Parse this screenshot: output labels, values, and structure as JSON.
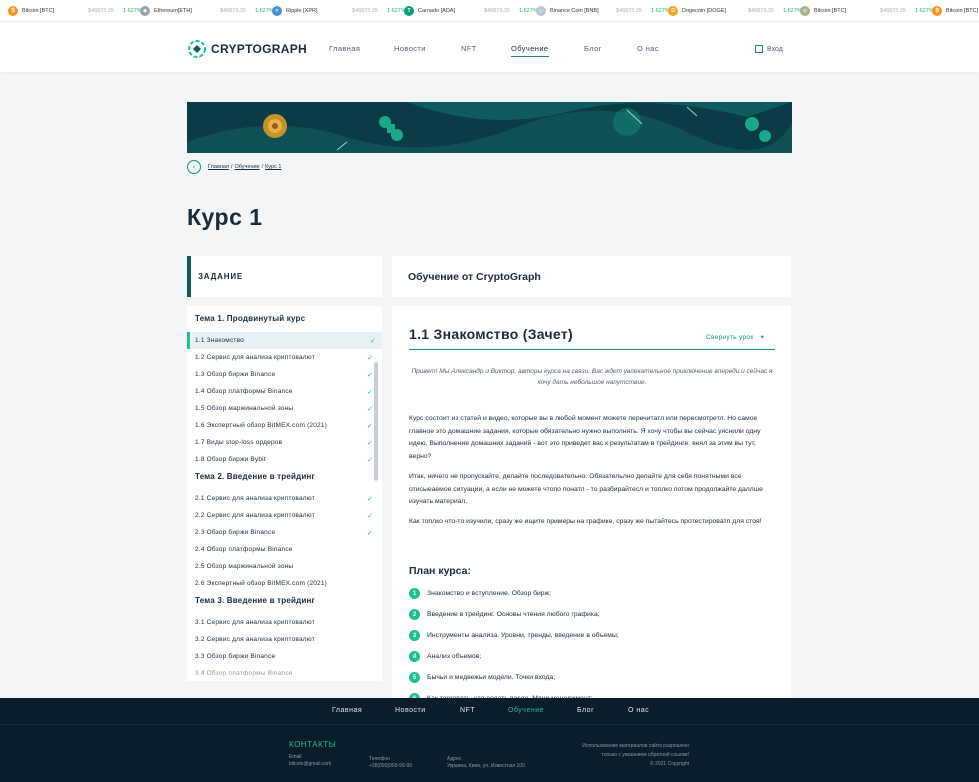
{
  "ticker": [
    {
      "name": "Bitcoin [BTC]",
      "price": "$46873.35",
      "change": "1.627%",
      "color": "#f7931a",
      "symbol": "₿"
    },
    {
      "name": "Ethereum[ETH]",
      "price": "$46873.35",
      "change": "1.627%",
      "color": "#9ea4ad",
      "symbol": "◆"
    },
    {
      "name": "Ripple [XPR]",
      "price": "$46873.35",
      "change": "1.627%",
      "color": "#4b8ed8",
      "symbol": "✕"
    },
    {
      "name": "Carnado [ADA]",
      "price": "$46873.35",
      "change": "1.627%",
      "color": "#0a9e7e",
      "symbol": "T"
    },
    {
      "name": "Binance Coin [BNB]",
      "price": "$46873.35",
      "change": "1.627%",
      "color": "#b9c7d4",
      "symbol": "◇"
    },
    {
      "name": "Dogecoin [DOGE]",
      "price": "$46873.35",
      "change": "1.627%",
      "color": "#f4a623",
      "symbol": "D"
    },
    {
      "name": "Bitcoin [BTC]",
      "price": "$46873.35",
      "change": "1.627%",
      "color": "#a3b18a",
      "symbol": "◎"
    },
    {
      "name": "Bitcoin [BTC]",
      "price": "",
      "change": "",
      "color": "#f7931a",
      "symbol": "₿"
    }
  ],
  "header": {
    "logo": "CRYPTOGRAPH",
    "nav": [
      "Главная",
      "Новости",
      "NFT",
      "Обучение",
      "Блог",
      "О нас"
    ],
    "active_nav": "Обучение",
    "login": "Вход"
  },
  "breadcrumb": [
    "Главная",
    "Обучение",
    "Курс 1"
  ],
  "page_title": "Курс 1",
  "sidebar": {
    "header": "ЗАДАНИЕ",
    "topics": [
      {
        "title": "Тема 1. Продвинутый курс",
        "lessons": [
          {
            "label": "1.1 Знакомство",
            "done": true,
            "active": true
          },
          {
            "label": "1.2 Сервис для анализа криптовалют",
            "done": true
          },
          {
            "label": "1.3 Обзор биржи Binance",
            "done": true
          },
          {
            "label": "1.4 Обзор платформы Binance",
            "done": true
          },
          {
            "label": "1.5 Обзор маржинальной зоны",
            "done": true
          },
          {
            "label": "1.6 Экспертный обзор BitMEX.com (2021)",
            "done": true
          },
          {
            "label": "1.7 Виды stop-loss ордеров",
            "done": true
          },
          {
            "label": "1.8 Обзор биржи Bybit",
            "done": true
          }
        ]
      },
      {
        "title": "Тема 2. Введение в трейдинг",
        "lessons": [
          {
            "label": "2.1 Сервис для анализа криптовалют",
            "done": true
          },
          {
            "label": "2.2 Сервис для анализа криптовалют",
            "done": true
          },
          {
            "label": "2.3 Обзор биржи Binance",
            "done": true
          },
          {
            "label": "2.4 Обзор платформы Binance",
            "done": false
          },
          {
            "label": "2.5 Обзор маржинальной зоны",
            "done": false
          },
          {
            "label": "2.6 Экспертный обзор BitMEX.com (2021)",
            "done": false
          }
        ]
      },
      {
        "title": "Тема 3. Введение в трейдинг",
        "lessons": [
          {
            "label": "3.1 Сервис для анализа криптовалют",
            "done": false
          },
          {
            "label": "3.2 Сервис для анализа криптовалют",
            "done": false
          },
          {
            "label": "3.3 Обзор биржи Binance",
            "done": false
          },
          {
            "label": "3.4 Обзор платформы Binance",
            "done": false
          }
        ]
      }
    ]
  },
  "content": {
    "subheader": "Обучение от CryptoGraph",
    "lesson_title": "1.1 Знакомство (Зачет)",
    "collapse_label": "Свернуть урок",
    "intro": "Привет! Мы Александр и Виктор, авторы курса на связи. Вас ждет увлекательное приключение впереди и сейчас я хочу дать небольшое напутствие.",
    "paragraphs": [
      "Курс состоит из статей и видео, которые вы в любой момент можете перечитатл или пересмотретл. Но самое главное это домашние задания, которые обязательно нужно выполнять. Я хочу чтобы вы сейчас уяснили одну идею. Выполнение домашних заданий - вот это приведет вас к результатам в трейдинге. веял за этим вы тут, верно?",
      "Итак, ничего не пропускайте, делайте последовательно. Обязательлно делайте для себя понятными все отисыеаемое ситуации, а если не можете чтопо понатл - то разбирайтесл и топлко потом продолжайте даллше изучать материал.",
      "Как топлко что-то изучили, сразу же ищите примеры на графике, сразу же пытайтесь протестироватл для стоя!"
    ],
    "plan_title": "План курса:",
    "plan": [
      "Знакомство и вступление. Обзор бирж;",
      "Введение в трейдинг. Основы чтения любого графика;",
      "Инструменты анализа. Уровни, тренды, введение в объемы;",
      "Анализ объемов;",
      "Бычьи и медвежьи модели. Точки входа;",
      "Как торговать, что делать после. Мани менеджмент;"
    ]
  },
  "footer": {
    "nav": [
      "Главная",
      "Новости",
      "NFT",
      "Обучение",
      "Блог",
      "О нас"
    ],
    "active_nav": "Обучение",
    "contacts_title": "КОНТАКТЫ",
    "email_label": "Email",
    "email": "bitcoin@gmail.com",
    "phone_label": "Телефон",
    "phone": "+38(099)999-99-99",
    "address_label": "Адрес",
    "address": "Украина, Киев, ул. Известная 100",
    "copyright_lines": [
      "Использование материалов сайта разрешено",
      "только с указанием обратной ссылки!",
      "© 2021 Copyright"
    ]
  },
  "colors": {
    "accent": "#1fbf8f",
    "dark": "#0b1d2a",
    "text": "#1a2b3c"
  }
}
